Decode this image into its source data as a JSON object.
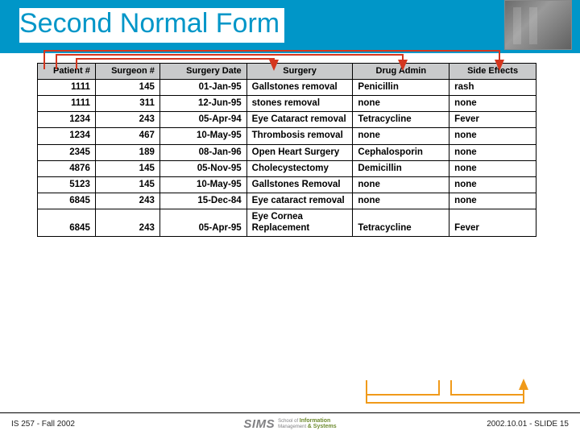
{
  "title": "Second Normal Form",
  "headers": [
    "Patient #",
    "Surgeon #",
    "Surgery Date",
    "Surgery",
    "Drug Admin",
    "Side Effects"
  ],
  "rows": [
    {
      "patient": "1111",
      "surgeon": "145",
      "date": "01-Jan-95",
      "surgery": "Gallstones removal",
      "drug": "Penicillin",
      "side": "rash"
    },
    {
      "patient": "1111",
      "surgeon": "311",
      "date": "12-Jun-95",
      "surgery": "stones removal",
      "drug": "none",
      "side": "none"
    },
    {
      "patient": "1234",
      "surgeon": "243",
      "date": "05-Apr-94",
      "surgery": "Eye Cataract removal",
      "drug": "Tetracycline",
      "side": "Fever"
    },
    {
      "patient": "1234",
      "surgeon": "467",
      "date": "10-May-95",
      "surgery": "Thrombosis removal",
      "drug": "none",
      "side": "none"
    },
    {
      "patient": "2345",
      "surgeon": "189",
      "date": "08-Jan-96",
      "surgery": "Open Heart Surgery",
      "drug": "Cephalosporin",
      "side": "none"
    },
    {
      "patient": "4876",
      "surgeon": "145",
      "date": "05-Nov-95",
      "surgery": "Cholecystectomy",
      "drug": "Demicillin",
      "side": "none"
    },
    {
      "patient": "5123",
      "surgeon": "145",
      "date": "10-May-95",
      "surgery": "Gallstones Removal",
      "drug": "none",
      "side": "none"
    },
    {
      "patient": "6845",
      "surgeon": "243",
      "date": "15-Dec-84",
      "surgery": "Eye cataract removal",
      "drug": "none",
      "side": "none"
    },
    {
      "patient": "6845",
      "surgeon": "243",
      "date": "05-Apr-95",
      "surgery": "Eye Cornea Replacement",
      "drug": "Tetracycline",
      "side": "Fever"
    }
  ],
  "footer": {
    "left": "IS 257 - Fall 2002",
    "right": "2002.10.01 - SLIDE 15",
    "logo_main": "SIMS",
    "logo_line1a": "School of ",
    "logo_line1b": "Information",
    "logo_line2a": "Management ",
    "logo_line2b": "& Systems"
  }
}
